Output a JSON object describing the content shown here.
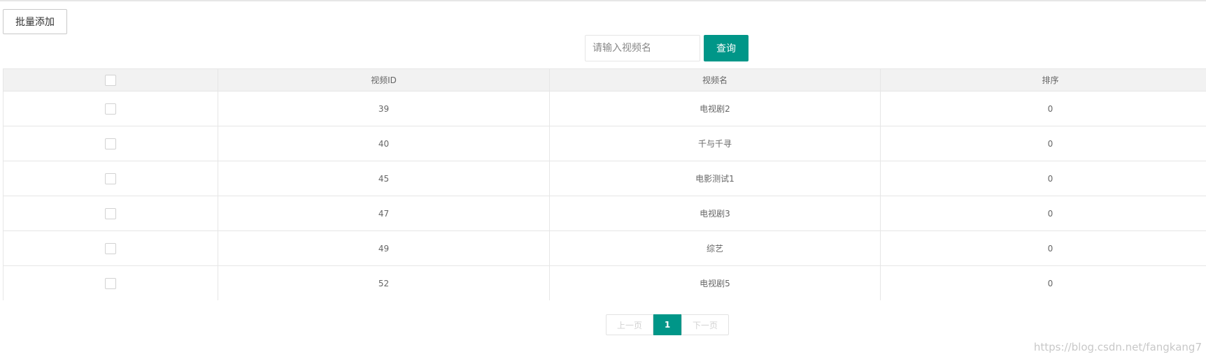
{
  "toolbar": {
    "batch_add_label": "批量添加"
  },
  "search": {
    "placeholder": "请输入视频名",
    "value": "",
    "query_label": "查询"
  },
  "table": {
    "headers": [
      "视频ID",
      "视频名",
      "排序"
    ],
    "rows": [
      {
        "id": "39",
        "name": "电视剧2",
        "sort": "0"
      },
      {
        "id": "40",
        "name": "千与千寻",
        "sort": "0"
      },
      {
        "id": "45",
        "name": "电影测试1",
        "sort": "0"
      },
      {
        "id": "47",
        "name": "电视剧3",
        "sort": "0"
      },
      {
        "id": "49",
        "name": "综艺",
        "sort": "0"
      },
      {
        "id": "52",
        "name": "电视剧5",
        "sort": "0"
      }
    ]
  },
  "pagination": {
    "prev_label": "上一页",
    "current_page": "1",
    "next_label": "下一页"
  },
  "watermark": "https://blog.csdn.net/fangkang7",
  "colors": {
    "accent": "#009688",
    "border": "#e6e6e6",
    "header_bg": "#f2f2f2",
    "text": "#666666"
  }
}
